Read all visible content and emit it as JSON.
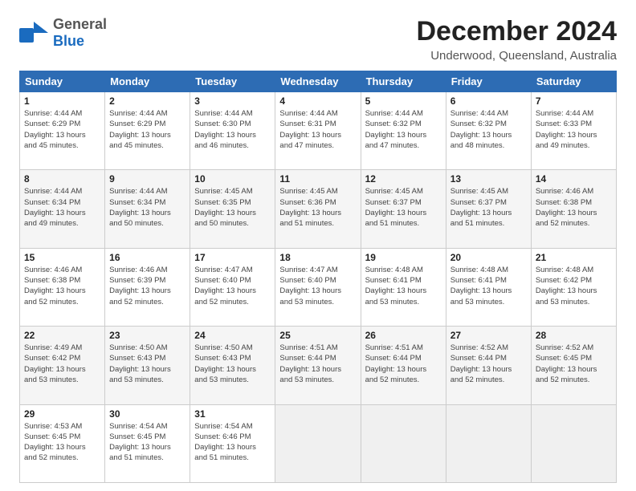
{
  "logo": {
    "general": "General",
    "blue": "Blue"
  },
  "title": "December 2024",
  "location": "Underwood, Queensland, Australia",
  "days_of_week": [
    "Sunday",
    "Monday",
    "Tuesday",
    "Wednesday",
    "Thursday",
    "Friday",
    "Saturday"
  ],
  "weeks": [
    [
      {
        "day": "1",
        "info": "Sunrise: 4:44 AM\nSunset: 6:29 PM\nDaylight: 13 hours\nand 45 minutes."
      },
      {
        "day": "2",
        "info": "Sunrise: 4:44 AM\nSunset: 6:29 PM\nDaylight: 13 hours\nand 45 minutes."
      },
      {
        "day": "3",
        "info": "Sunrise: 4:44 AM\nSunset: 6:30 PM\nDaylight: 13 hours\nand 46 minutes."
      },
      {
        "day": "4",
        "info": "Sunrise: 4:44 AM\nSunset: 6:31 PM\nDaylight: 13 hours\nand 47 minutes."
      },
      {
        "day": "5",
        "info": "Sunrise: 4:44 AM\nSunset: 6:32 PM\nDaylight: 13 hours\nand 47 minutes."
      },
      {
        "day": "6",
        "info": "Sunrise: 4:44 AM\nSunset: 6:32 PM\nDaylight: 13 hours\nand 48 minutes."
      },
      {
        "day": "7",
        "info": "Sunrise: 4:44 AM\nSunset: 6:33 PM\nDaylight: 13 hours\nand 49 minutes."
      }
    ],
    [
      {
        "day": "8",
        "info": "Sunrise: 4:44 AM\nSunset: 6:34 PM\nDaylight: 13 hours\nand 49 minutes."
      },
      {
        "day": "9",
        "info": "Sunrise: 4:44 AM\nSunset: 6:34 PM\nDaylight: 13 hours\nand 50 minutes."
      },
      {
        "day": "10",
        "info": "Sunrise: 4:45 AM\nSunset: 6:35 PM\nDaylight: 13 hours\nand 50 minutes."
      },
      {
        "day": "11",
        "info": "Sunrise: 4:45 AM\nSunset: 6:36 PM\nDaylight: 13 hours\nand 51 minutes."
      },
      {
        "day": "12",
        "info": "Sunrise: 4:45 AM\nSunset: 6:37 PM\nDaylight: 13 hours\nand 51 minutes."
      },
      {
        "day": "13",
        "info": "Sunrise: 4:45 AM\nSunset: 6:37 PM\nDaylight: 13 hours\nand 51 minutes."
      },
      {
        "day": "14",
        "info": "Sunrise: 4:46 AM\nSunset: 6:38 PM\nDaylight: 13 hours\nand 52 minutes."
      }
    ],
    [
      {
        "day": "15",
        "info": "Sunrise: 4:46 AM\nSunset: 6:38 PM\nDaylight: 13 hours\nand 52 minutes."
      },
      {
        "day": "16",
        "info": "Sunrise: 4:46 AM\nSunset: 6:39 PM\nDaylight: 13 hours\nand 52 minutes."
      },
      {
        "day": "17",
        "info": "Sunrise: 4:47 AM\nSunset: 6:40 PM\nDaylight: 13 hours\nand 52 minutes."
      },
      {
        "day": "18",
        "info": "Sunrise: 4:47 AM\nSunset: 6:40 PM\nDaylight: 13 hours\nand 53 minutes."
      },
      {
        "day": "19",
        "info": "Sunrise: 4:48 AM\nSunset: 6:41 PM\nDaylight: 13 hours\nand 53 minutes."
      },
      {
        "day": "20",
        "info": "Sunrise: 4:48 AM\nSunset: 6:41 PM\nDaylight: 13 hours\nand 53 minutes."
      },
      {
        "day": "21",
        "info": "Sunrise: 4:48 AM\nSunset: 6:42 PM\nDaylight: 13 hours\nand 53 minutes."
      }
    ],
    [
      {
        "day": "22",
        "info": "Sunrise: 4:49 AM\nSunset: 6:42 PM\nDaylight: 13 hours\nand 53 minutes."
      },
      {
        "day": "23",
        "info": "Sunrise: 4:50 AM\nSunset: 6:43 PM\nDaylight: 13 hours\nand 53 minutes."
      },
      {
        "day": "24",
        "info": "Sunrise: 4:50 AM\nSunset: 6:43 PM\nDaylight: 13 hours\nand 53 minutes."
      },
      {
        "day": "25",
        "info": "Sunrise: 4:51 AM\nSunset: 6:44 PM\nDaylight: 13 hours\nand 53 minutes."
      },
      {
        "day": "26",
        "info": "Sunrise: 4:51 AM\nSunset: 6:44 PM\nDaylight: 13 hours\nand 52 minutes."
      },
      {
        "day": "27",
        "info": "Sunrise: 4:52 AM\nSunset: 6:44 PM\nDaylight: 13 hours\nand 52 minutes."
      },
      {
        "day": "28",
        "info": "Sunrise: 4:52 AM\nSunset: 6:45 PM\nDaylight: 13 hours\nand 52 minutes."
      }
    ],
    [
      {
        "day": "29",
        "info": "Sunrise: 4:53 AM\nSunset: 6:45 PM\nDaylight: 13 hours\nand 52 minutes."
      },
      {
        "day": "30",
        "info": "Sunrise: 4:54 AM\nSunset: 6:45 PM\nDaylight: 13 hours\nand 51 minutes."
      },
      {
        "day": "31",
        "info": "Sunrise: 4:54 AM\nSunset: 6:46 PM\nDaylight: 13 hours\nand 51 minutes."
      },
      {
        "day": "",
        "info": ""
      },
      {
        "day": "",
        "info": ""
      },
      {
        "day": "",
        "info": ""
      },
      {
        "day": "",
        "info": ""
      }
    ]
  ]
}
